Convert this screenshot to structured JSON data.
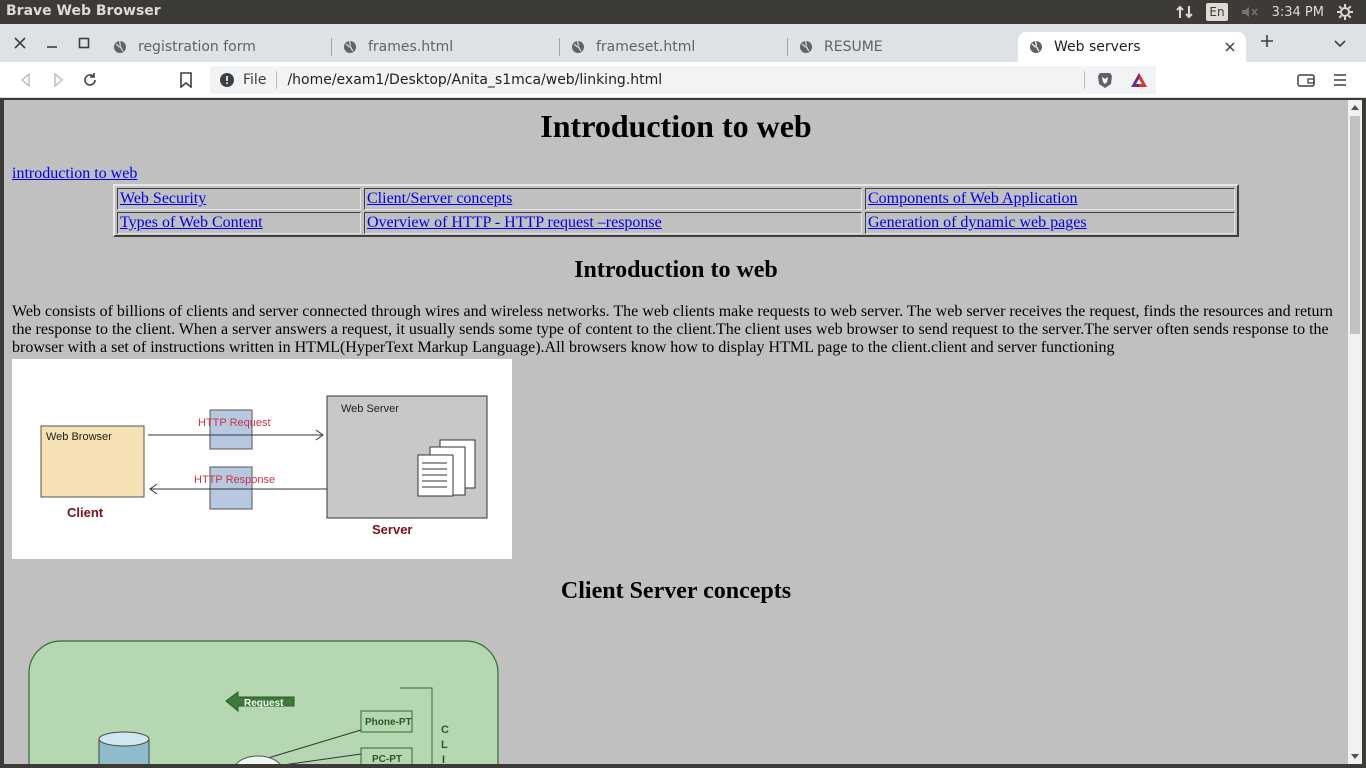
{
  "os": {
    "window_title": "Brave Web Browser",
    "keyboard_layout": "En",
    "clock": "3:34 PM"
  },
  "tabs": [
    {
      "label": "registration form",
      "active": false
    },
    {
      "label": "frames.html",
      "active": false
    },
    {
      "label": "frameset.html",
      "active": false
    },
    {
      "label": "RESUME",
      "active": false
    },
    {
      "label": "Web servers",
      "active": true
    }
  ],
  "toolbar": {
    "scheme_label": "File",
    "url": "/home/exam1/Desktop/Anita_s1mca/web/linking.html"
  },
  "page": {
    "title": "Introduction to web",
    "top_link": "introduction to web",
    "nav_table": [
      [
        "Web Security",
        "Client/Server concepts",
        "Components of Web Application"
      ],
      [
        "Types of Web Content",
        "Overview of HTTP - HTTP request –response",
        "Generation of dynamic web pages"
      ]
    ],
    "section1_heading": "Introduction to web",
    "section1_text": "Web consists of billions of clients and server connected through wires and wireless networks. The web clients make requests to web server. The web server receives the request, finds the resources and return the response to the client. When a server answers a request, it usually sends some type of content to the client.The client uses web browser to send request to the server.The server often sends response to the browser with a set of instructions written in HTML(HyperText Markup Language).All browsers know how to display HTML page to the client.client and server functioning",
    "diagram1": {
      "browser_box": "Web Browser",
      "client_label": "Client",
      "request_label": "HTTP Request",
      "response_label": "HTTP Response",
      "server_box": "Web Server",
      "server_label": "Server"
    },
    "section2_heading": "Client Server concepts",
    "diagram2": {
      "request_label": "Request",
      "device1": "Phone-PT",
      "device2": "PC-PT",
      "vertical_text": "CLI"
    }
  },
  "colors": {
    "page_background": "#c0c0c0",
    "link": "#0000ee",
    "os_bar": "#3c3b37",
    "tabstrip": "#dee1e6"
  }
}
